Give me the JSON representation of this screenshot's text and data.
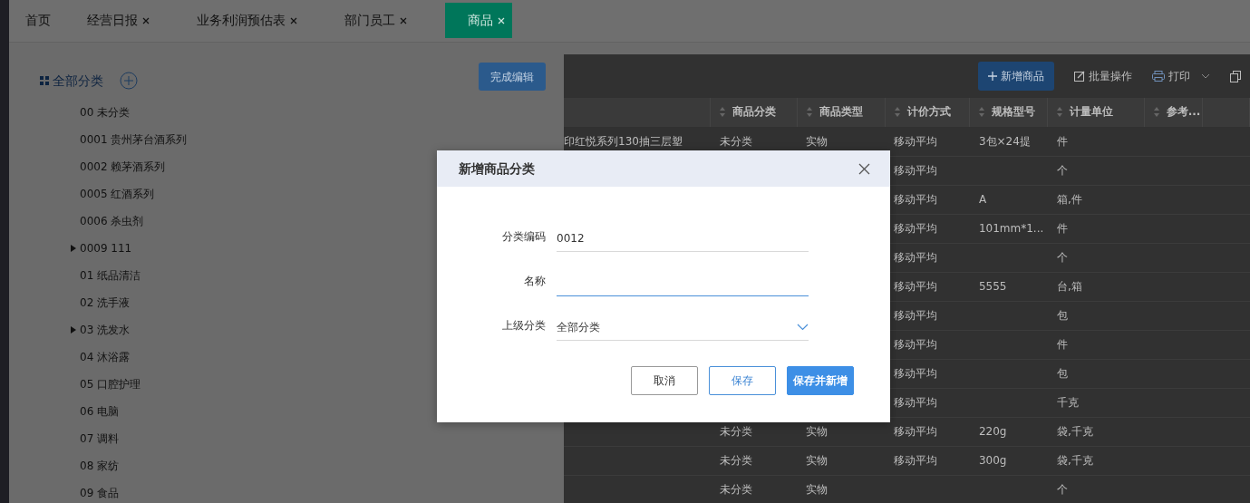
{
  "tabs": [
    {
      "label": "首页",
      "closable": false,
      "selected": false
    },
    {
      "label": "经营日报",
      "closable": true,
      "selected": false
    },
    {
      "label": "业务利润预估表",
      "closable": true,
      "selected": false
    },
    {
      "label": "部门员工",
      "closable": true,
      "selected": false
    },
    {
      "label": "商品",
      "closable": true,
      "selected": true
    }
  ],
  "category_panel": {
    "root": "全部分类",
    "done_button": "完成编辑",
    "items": [
      {
        "label": "00 未分类",
        "expandable": false
      },
      {
        "label": "0001 贵州茅台酒系列",
        "expandable": false
      },
      {
        "label": "0002 赖茅酒系列",
        "expandable": false
      },
      {
        "label": "0005 红酒系列",
        "expandable": false
      },
      {
        "label": "0006 杀虫剂",
        "expandable": false
      },
      {
        "label": "0009 111",
        "expandable": true
      },
      {
        "label": "01 纸品清洁",
        "expandable": false
      },
      {
        "label": "02 洗手液",
        "expandable": false
      },
      {
        "label": "03 洗发水",
        "expandable": true
      },
      {
        "label": "04 沐浴露",
        "expandable": false
      },
      {
        "label": "05 口腔护理",
        "expandable": false
      },
      {
        "label": "06 电脑",
        "expandable": false
      },
      {
        "label": "07 调料",
        "expandable": false
      },
      {
        "label": "08 家纺",
        "expandable": false
      },
      {
        "label": "09 食品",
        "expandable": false
      }
    ]
  },
  "product_panel": {
    "toolbar": [
      {
        "kind": "primary",
        "label": "新增商品"
      },
      {
        "kind": "edit",
        "label": "批量操作"
      },
      {
        "kind": "dropdown",
        "label": "打印"
      },
      {
        "kind": "icon"
      }
    ],
    "table": {
      "columns": [
        "",
        "商品分类",
        "商品类型",
        "计价方式",
        "规格型号",
        "计量单位",
        "参考..."
      ],
      "rows": [
        [
          "印红悦系列130抽三层塑",
          "未分类",
          "实物",
          "移动平均",
          "3包×24提",
          "件",
          ""
        ],
        [
          "",
          "",
          "",
          "移动平均",
          "",
          "个",
          ""
        ],
        [
          "",
          "",
          "",
          "移动平均",
          "A",
          "箱,件",
          ""
        ],
        [
          "",
          "",
          "",
          "移动平均",
          "101mm*1...",
          "件",
          ""
        ],
        [
          "",
          "",
          "",
          "移动平均",
          "",
          "个",
          ""
        ],
        [
          "",
          "",
          "",
          "移动平均",
          "5555",
          "台,箱",
          ""
        ],
        [
          "",
          "",
          "",
          "移动平均",
          "",
          "包",
          ""
        ],
        [
          "",
          "",
          "",
          "移动平均",
          "",
          "件",
          ""
        ],
        [
          "",
          "",
          "",
          "移动平均",
          "",
          "包",
          ""
        ],
        [
          "",
          "",
          "",
          "移动平均",
          "",
          "千克",
          ""
        ],
        [
          "",
          "未分类",
          "实物",
          "移动平均",
          "220g",
          "袋,千克",
          ""
        ],
        [
          "",
          "未分类",
          "实物",
          "移动平均",
          "300g",
          "袋,千克",
          ""
        ],
        [
          "",
          "未分类",
          "实物",
          "",
          "",
          "个",
          ""
        ]
      ]
    }
  },
  "dialog": {
    "title": "新增商品分类",
    "fields": [
      {
        "kind": "text",
        "label": "分类编码",
        "value": "0012",
        "focused": false
      },
      {
        "kind": "text",
        "label": "名称",
        "focused": true
      },
      {
        "kind": "select",
        "label": "上级分类",
        "value": "全部分类",
        "focused": false
      }
    ],
    "buttons": [
      {
        "kind": "default",
        "label": "取消"
      },
      {
        "kind": "outline",
        "label": "保存"
      },
      {
        "kind": "primary",
        "label": "保存并新增"
      }
    ]
  }
}
